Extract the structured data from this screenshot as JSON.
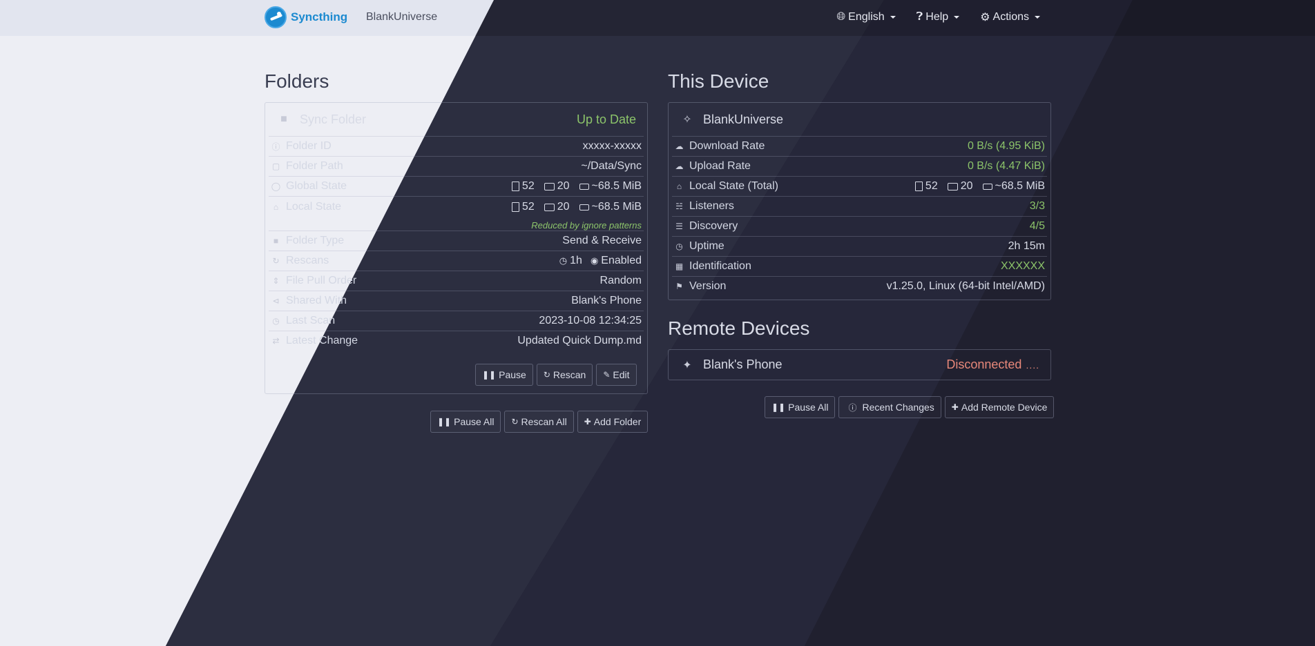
{
  "navbar": {
    "brand": "Syncthing",
    "device_name": "BlankUniverse",
    "menu": [
      {
        "label": "English",
        "icon": "globe-icon"
      },
      {
        "label": "Help",
        "icon": "question-icon"
      },
      {
        "label": "Actions",
        "icon": "gear-icon"
      }
    ]
  },
  "folders": {
    "title": "Folders",
    "folder": {
      "name": "Sync Folder",
      "status": "Up to Date",
      "rows": {
        "folder_id": {
          "label": "Folder ID",
          "value": "xxxxx-xxxxx"
        },
        "folder_path": {
          "label": "Folder Path",
          "value": "~/Data/Sync"
        },
        "global_state": {
          "label": "Global State",
          "files": "52",
          "dirs": "20",
          "size": "~68.5 MiB"
        },
        "local_state": {
          "label": "Local State",
          "files": "52",
          "dirs": "20",
          "size": "~68.5 MiB",
          "note": "Reduced by ignore patterns"
        },
        "folder_type": {
          "label": "Folder Type",
          "value": "Send & Receive"
        },
        "rescans": {
          "label": "Rescans",
          "interval": "1h",
          "watch": "Enabled"
        },
        "file_pull_order": {
          "label": "File Pull Order",
          "value": "Random"
        },
        "shared_with": {
          "label": "Shared With",
          "value": "Blank's Phone"
        },
        "last_scan": {
          "label": "Last Scan",
          "value": "2023-10-08 12:34:25"
        },
        "latest_change": {
          "label": "Latest Change",
          "value": "Updated Quick Dump.md"
        }
      },
      "buttons": {
        "pause": "Pause",
        "rescan": "Rescan",
        "edit": "Edit"
      }
    },
    "global_buttons": {
      "pause_all": "Pause All",
      "rescan_all": "Rescan All",
      "add_folder": "Add Folder"
    }
  },
  "this_device": {
    "title": "This Device",
    "name": "BlankUniverse",
    "rows": {
      "download_rate": {
        "label": "Download Rate",
        "value": "0 B/s (4.95 KiB)"
      },
      "upload_rate": {
        "label": "Upload Rate",
        "value": "0 B/s (4.47 KiB)"
      },
      "local_state": {
        "label": "Local State (Total)",
        "files": "52",
        "dirs": "20",
        "size": "~68.5 MiB"
      },
      "listeners": {
        "label": "Listeners",
        "value": "3/3"
      },
      "discovery": {
        "label": "Discovery",
        "value": "4/5"
      },
      "uptime": {
        "label": "Uptime",
        "value": "2h 15m"
      },
      "identification": {
        "label": "Identification",
        "value": "XXXXXX"
      },
      "version": {
        "label": "Version",
        "value": "v1.25.0, Linux (64-bit Intel/AMD)"
      }
    }
  },
  "remote_devices": {
    "title": "Remote Devices",
    "device": {
      "name": "Blank's Phone",
      "status": "Disconnected",
      "dots": "...."
    },
    "buttons": {
      "pause_all": "Pause All",
      "recent_changes": "Recent Changes",
      "add_remote": "Add Remote Device"
    }
  },
  "colors": {
    "ok": "#8cc46a",
    "bad": "#e8887a",
    "brand": "#1c8ad0"
  }
}
